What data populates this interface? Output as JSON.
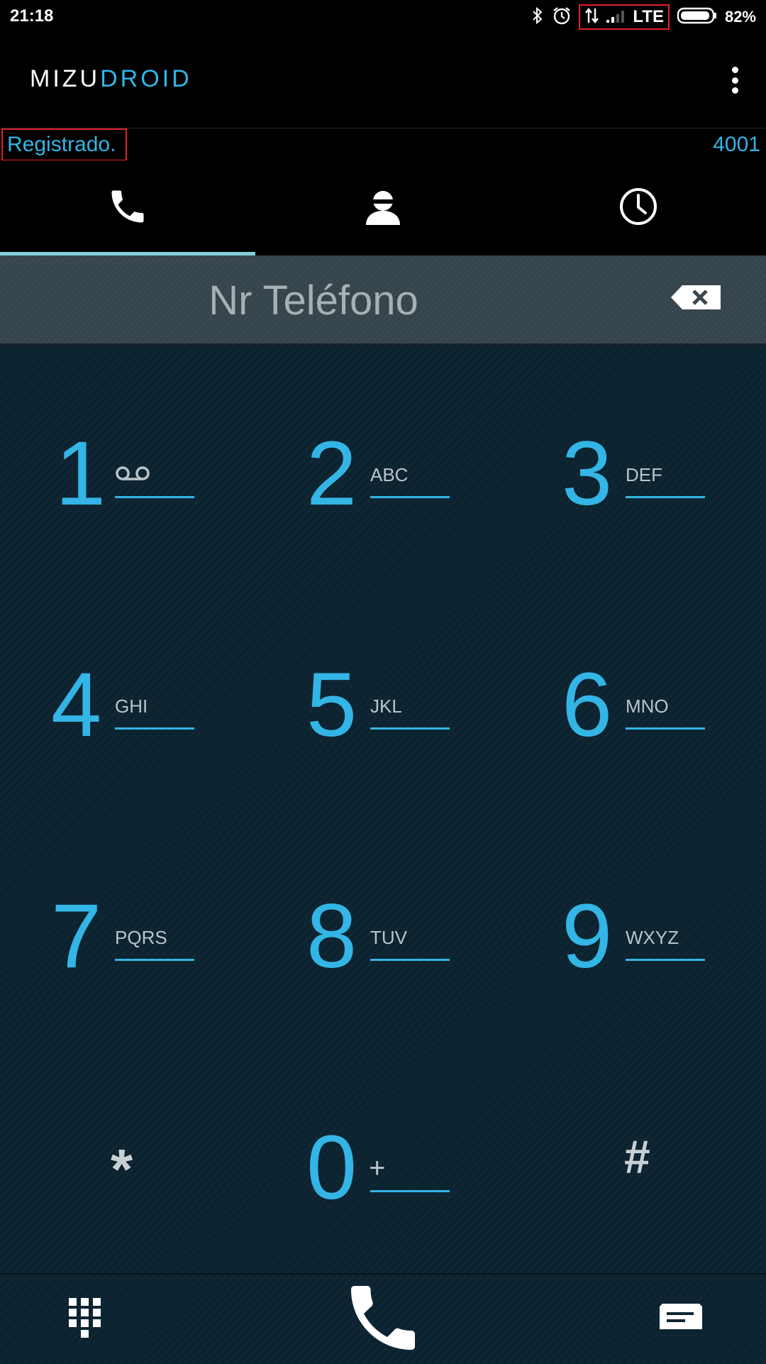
{
  "status_bar": {
    "time": "21:18",
    "network": "LTE",
    "battery": "82%"
  },
  "app": {
    "logo_part1": "MIZU",
    "logo_part2": "DROID"
  },
  "registration": {
    "status": "Registrado.",
    "extension": "4001"
  },
  "tabs": [
    {
      "icon": "phone-icon",
      "active": true
    },
    {
      "icon": "contact-icon",
      "active": false
    },
    {
      "icon": "history-clock-icon",
      "active": false
    }
  ],
  "dialer": {
    "placeholder": "Nr Teléfono",
    "keys": [
      {
        "digit": "1",
        "letters": ""
      },
      {
        "digit": "2",
        "letters": "ABC"
      },
      {
        "digit": "3",
        "letters": "DEF"
      },
      {
        "digit": "4",
        "letters": "GHI"
      },
      {
        "digit": "5",
        "letters": "JKL"
      },
      {
        "digit": "6",
        "letters": "MNO"
      },
      {
        "digit": "7",
        "letters": "PQRS"
      },
      {
        "digit": "8",
        "letters": "TUV"
      },
      {
        "digit": "9",
        "letters": "WXYZ"
      },
      {
        "digit": "*",
        "letters": ""
      },
      {
        "digit": "0",
        "letters": "+"
      },
      {
        "digit": "#",
        "letters": ""
      }
    ]
  },
  "colors": {
    "accent": "#33b5e5",
    "highlight_box": "#e0202a",
    "keypad_bg": "#0f2633"
  }
}
